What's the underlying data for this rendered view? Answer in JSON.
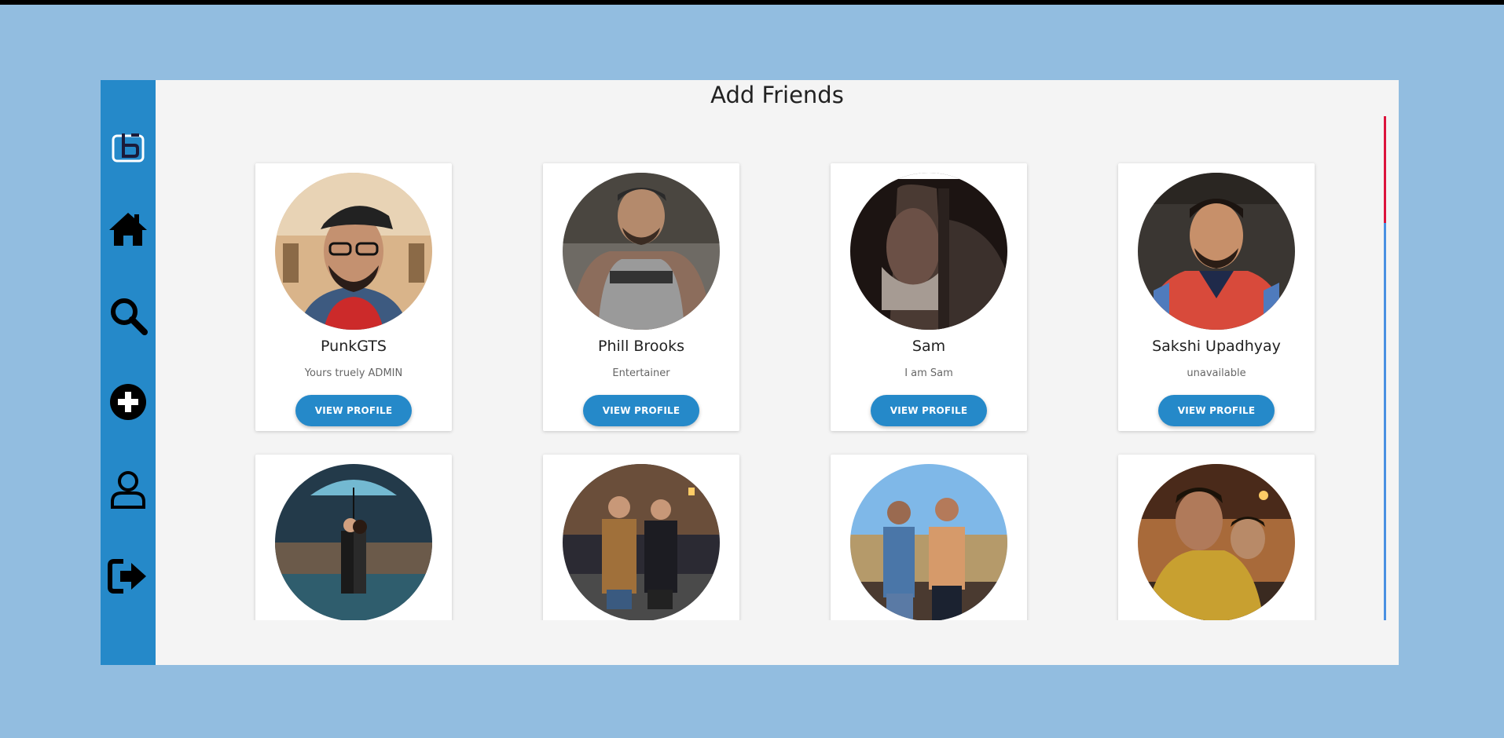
{
  "page": {
    "title": "Add Friends"
  },
  "sidebar": {
    "items": [
      {
        "name": "logo",
        "icon": "logo-icon"
      },
      {
        "name": "home",
        "icon": "home-icon"
      },
      {
        "name": "search",
        "icon": "search-icon"
      },
      {
        "name": "add",
        "icon": "plus-circle-icon"
      },
      {
        "name": "profile",
        "icon": "user-icon"
      },
      {
        "name": "logout",
        "icon": "sign-out-icon"
      }
    ]
  },
  "friends": [
    {
      "name": "PunkGTS",
      "status": "Yours truely ADMIN",
      "button": "VIEW PROFILE"
    },
    {
      "name": "Phill Brooks",
      "status": "Entertainer",
      "button": "VIEW PROFILE"
    },
    {
      "name": "Sam",
      "status": "I am Sam",
      "button": "VIEW PROFILE"
    },
    {
      "name": "Sakshi Upadhyay",
      "status": "unavailable",
      "button": "VIEW PROFILE"
    },
    {
      "name": "",
      "status": "",
      "button": ""
    },
    {
      "name": "",
      "status": "",
      "button": ""
    },
    {
      "name": "",
      "status": "",
      "button": ""
    },
    {
      "name": "",
      "status": "",
      "button": ""
    }
  ],
  "colors": {
    "background": "#92bde0",
    "sidebar": "#2589c9",
    "button": "#2589c9",
    "scroll_thumb": "#dc143c",
    "scroll_track": "#4a90e2"
  }
}
